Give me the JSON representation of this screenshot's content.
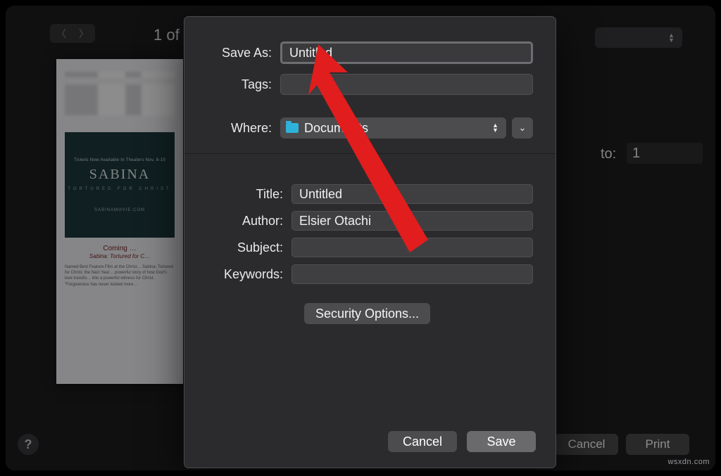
{
  "page_counter": "1 of",
  "range": {
    "to_label": "to:",
    "to_value": "1"
  },
  "buttons": {
    "cancel_outer": "Cancel",
    "print_outer": "Print",
    "help": "?"
  },
  "preview": {
    "ad_top": "Tickets Now Available\nIn Theaters Nov. 8-10",
    "ad_title": "SABINA",
    "ad_sub": "TORTURED FOR CHRIST",
    "ad_site": "SABINAMOVIE.COM",
    "article_coming": "Coming …",
    "article_title": "Sabina: Tortured for C…",
    "article_p1": "Named Best Feature Film at the Christ… Sabina: Tortured for Christ, the Nazi Year… powerful story of how God's love transfo… into a powerful witness for Christ.",
    "article_p2": "\"Forgiveness has never looked more…"
  },
  "sheet": {
    "save_as_label": "Save As:",
    "save_as_value": "Untitled",
    "tags_label": "Tags:",
    "tags_value": "",
    "where_label": "Where:",
    "where_value": "Documents",
    "title_label": "Title:",
    "title_value": "Untitled",
    "author_label": "Author:",
    "author_value": "Elsier Otachi",
    "subject_label": "Subject:",
    "subject_value": "",
    "keywords_label": "Keywords:",
    "keywords_value": "",
    "security_button": "Security Options...",
    "cancel": "Cancel",
    "save": "Save"
  },
  "watermark": "wsxdn.com"
}
